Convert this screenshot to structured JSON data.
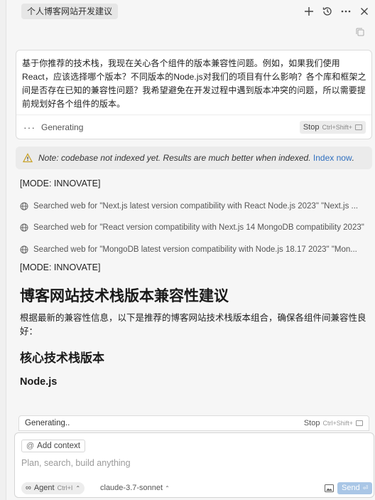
{
  "header": {
    "title": "个人博客网站开发建议",
    "icons": [
      "plus-icon",
      "history-icon",
      "more-icon",
      "close-icon"
    ]
  },
  "user_message": {
    "text": "基于你推荐的技术栈，我现在关心各个组件的版本兼容性问题。例如，如果我们使用React，应该选择哪个版本？不同版本的Node.js对我们的项目有什么影响？各个库和框架之间是否存在已知的兼容性问题？我希望避免在开发过程中遇到版本冲突的问题，所以需要提前规划好各个组件的版本。",
    "status": "Generating",
    "stop_label": "Stop",
    "stop_shortcut": "Ctrl+Shift+"
  },
  "note": {
    "text": "Note: codebase not indexed yet. Results are much better when indexed.",
    "link": "Index now",
    "after_link": "."
  },
  "content": {
    "mode1": "[MODE: INNOVATE]",
    "searches": [
      "Searched web for \"Next.js latest version compatibility with React Node.js 2023\" \"Next.js ...",
      "Searched web for \"React version compatibility with Next.js 14 MongoDB compatibility 2023\"",
      "Searched web for \"MongoDB latest version compatibility with Node.js 18.17 2023\" \"Mon..."
    ],
    "mode2": "[MODE: INNOVATE]",
    "heading": "博客网站技术栈版本兼容性建议",
    "intro": "根据最新的兼容性信息，以下是推荐的博客网站技术栈版本组合，确保各组件间兼容性良好：",
    "subheading": "核心技术栈版本",
    "subsubheading": "Node.js"
  },
  "generating_strip": {
    "text": "Generating..",
    "stop_label": "Stop",
    "stop_shortcut": "Ctrl+Shift+"
  },
  "composer": {
    "add_context": "Add context",
    "placeholder": "Plan, search, build anything",
    "agent_label": "Agent",
    "agent_shortcut": "Ctrl+I",
    "model": "claude-3.7-sonnet",
    "send_label": "Send"
  },
  "colors": {
    "link": "#2f6fbf",
    "send_bg": "#a9c6e6",
    "warning": "#c9a227"
  }
}
